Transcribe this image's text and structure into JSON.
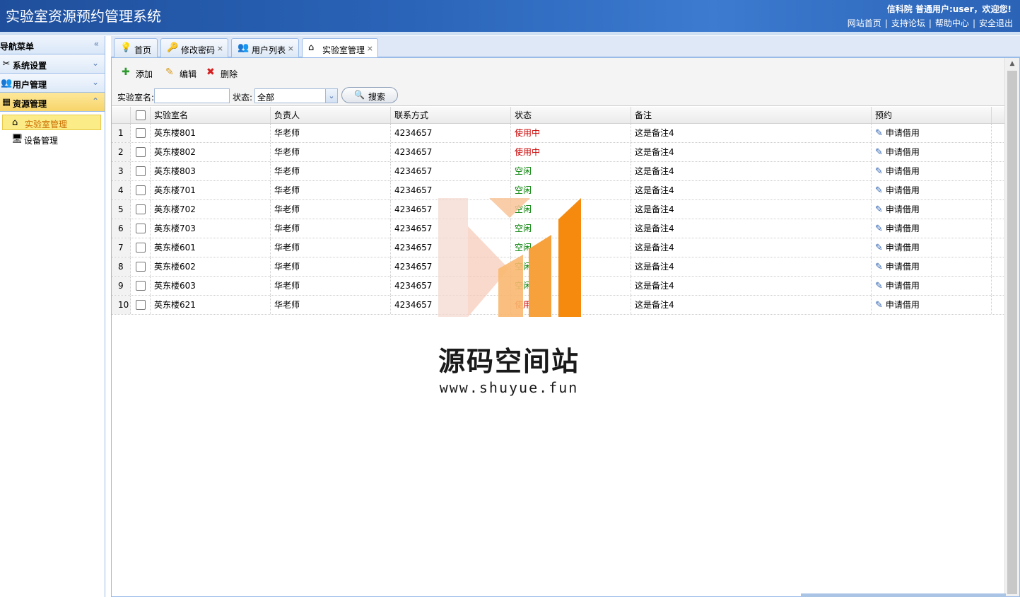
{
  "app": {
    "title": "实验室资源预约管理系统",
    "welcome": "信科院 普通用户:user，欢迎您!",
    "links": [
      "网站首页",
      "支持论坛",
      "帮助中心",
      "安全退出"
    ]
  },
  "sidebar": {
    "header": "导航菜单",
    "sections": [
      {
        "label": "系统设置",
        "icon": "tools-icon"
      },
      {
        "label": "用户管理",
        "icon": "users-icon"
      },
      {
        "label": "资源管理",
        "icon": "grid-icon",
        "expanded": true
      }
    ],
    "items": [
      {
        "label": "实验室管理",
        "icon": "home-icon",
        "active": true
      },
      {
        "label": "设备管理",
        "icon": "computer-icon"
      }
    ]
  },
  "tabs": [
    {
      "label": "首页",
      "icon": "bulb-icon",
      "closable": false
    },
    {
      "label": "修改密码",
      "icon": "key-icon",
      "closable": true
    },
    {
      "label": "用户列表",
      "icon": "users-icon",
      "closable": true
    },
    {
      "label": "实验室管理",
      "icon": "home-icon",
      "closable": true,
      "active": true
    }
  ],
  "toolbar": {
    "add": "添加",
    "edit": "编辑",
    "delete": "删除",
    "name_label": "实验室名:",
    "name_value": "",
    "status_label": "状态:",
    "status_value": "全部",
    "search": "搜索"
  },
  "grid": {
    "columns": [
      "实验室名",
      "负责人",
      "联系方式",
      "状态",
      "备注",
      "预约"
    ],
    "rows": [
      {
        "num": "1",
        "name": "英东楼801",
        "owner": "华老师",
        "phone": "4234657",
        "status": "使用中",
        "busy": true,
        "note": "这是备注4",
        "book": "申请借用"
      },
      {
        "num": "2",
        "name": "英东楼802",
        "owner": "华老师",
        "phone": "4234657",
        "status": "使用中",
        "busy": true,
        "note": "这是备注4",
        "book": "申请借用"
      },
      {
        "num": "3",
        "name": "英东楼803",
        "owner": "华老师",
        "phone": "4234657",
        "status": "空闲",
        "busy": false,
        "note": "这是备注4",
        "book": "申请借用"
      },
      {
        "num": "4",
        "name": "英东楼701",
        "owner": "华老师",
        "phone": "4234657",
        "status": "空闲",
        "busy": false,
        "note": "这是备注4",
        "book": "申请借用"
      },
      {
        "num": "5",
        "name": "英东楼702",
        "owner": "华老师",
        "phone": "4234657",
        "status": "空闲",
        "busy": false,
        "note": "这是备注4",
        "book": "申请借用"
      },
      {
        "num": "6",
        "name": "英东楼703",
        "owner": "华老师",
        "phone": "4234657",
        "status": "空闲",
        "busy": false,
        "note": "这是备注4",
        "book": "申请借用"
      },
      {
        "num": "7",
        "name": "英东楼601",
        "owner": "华老师",
        "phone": "4234657",
        "status": "空闲",
        "busy": false,
        "note": "这是备注4",
        "book": "申请借用"
      },
      {
        "num": "8",
        "name": "英东楼602",
        "owner": "华老师",
        "phone": "4234657",
        "status": "空闲",
        "busy": false,
        "note": "这是备注4",
        "book": "申请借用"
      },
      {
        "num": "9",
        "name": "英东楼603",
        "owner": "华老师",
        "phone": "4234657",
        "status": "空闲",
        "busy": false,
        "note": "这是备注4",
        "book": "申请借用"
      },
      {
        "num": "10",
        "name": "英东楼621",
        "owner": "华老师",
        "phone": "4234657",
        "status": "使用中",
        "busy": true,
        "note": "这是备注4",
        "book": "申请借用"
      }
    ]
  },
  "watermark": {
    "name": "源码空间站",
    "url": "www.shuyue.fun"
  },
  "colors": {
    "header": "#2a64b8",
    "busy": "#cc0000",
    "free": "#008000",
    "active_nav": "#f7d46a"
  }
}
